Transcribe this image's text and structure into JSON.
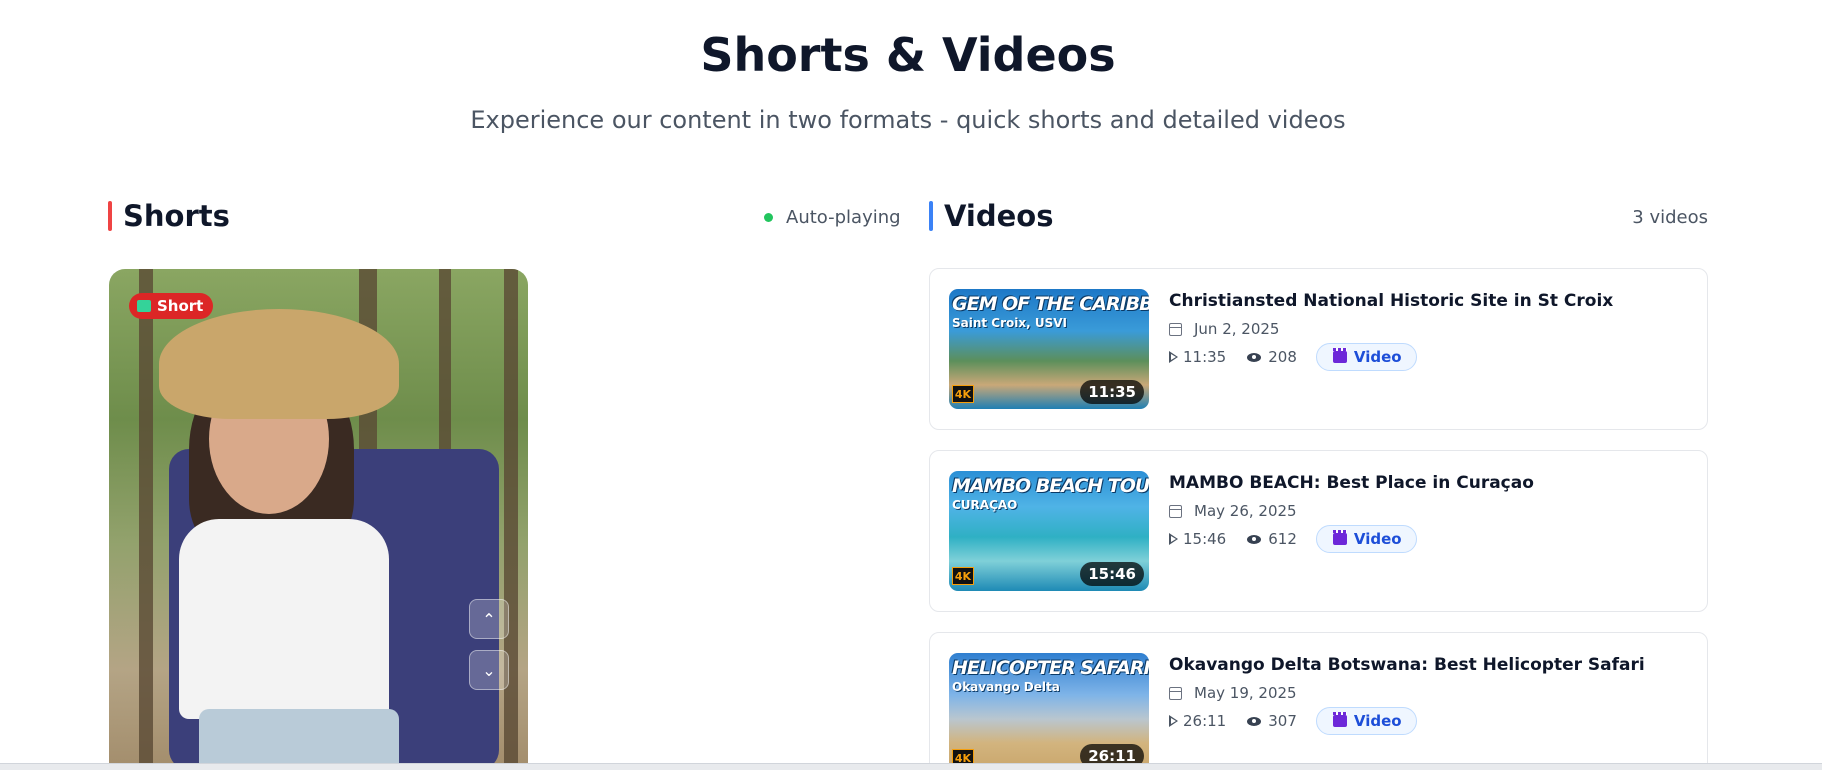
{
  "header": {
    "title": "Shorts & Videos",
    "subtitle": "Experience our content in two formats - quick shorts and detailed videos"
  },
  "shorts": {
    "heading": "Shorts",
    "status": "Auto-playing",
    "badge": "Short",
    "colors": {
      "accent": "#ef4444",
      "status_dot": "#22c55e",
      "badge": "#dc2626"
    },
    "icons": {
      "nav_up": "chevron-up-icon",
      "nav_down": "chevron-down-icon"
    },
    "nav_up_glyph": "⌃",
    "nav_down_glyph": "⌄"
  },
  "videos": {
    "heading": "Videos",
    "count": "3 videos",
    "colors": {
      "accent": "#3b82f6",
      "pill": "#1d4ed8"
    },
    "items": [
      {
        "title": "Christiansted National Historic Site in St Croix",
        "date": "Jun 2, 2025",
        "duration": "11:35",
        "views": "208",
        "type": "Video",
        "thumb_headline": "GEM OF THE CARIBBEAN!",
        "thumb_subhead": "Saint Croix, USVI",
        "thumb_badge": "4K"
      },
      {
        "title": "MAMBO BEACH: Best Place in Curaçao",
        "date": "May 26, 2025",
        "duration": "15:46",
        "views": "612",
        "type": "Video",
        "thumb_headline": "MAMBO BEACH TOUR!",
        "thumb_subhead": "CURAÇAO",
        "thumb_badge": "4K"
      },
      {
        "title": "Okavango Delta Botswana: Best Helicopter Safari",
        "date": "May 19, 2025",
        "duration": "26:11",
        "views": "307",
        "type": "Video",
        "thumb_headline": "HELICOPTER SAFARI!",
        "thumb_subhead": "Okavango Delta",
        "thumb_badge": "4K"
      }
    ]
  }
}
